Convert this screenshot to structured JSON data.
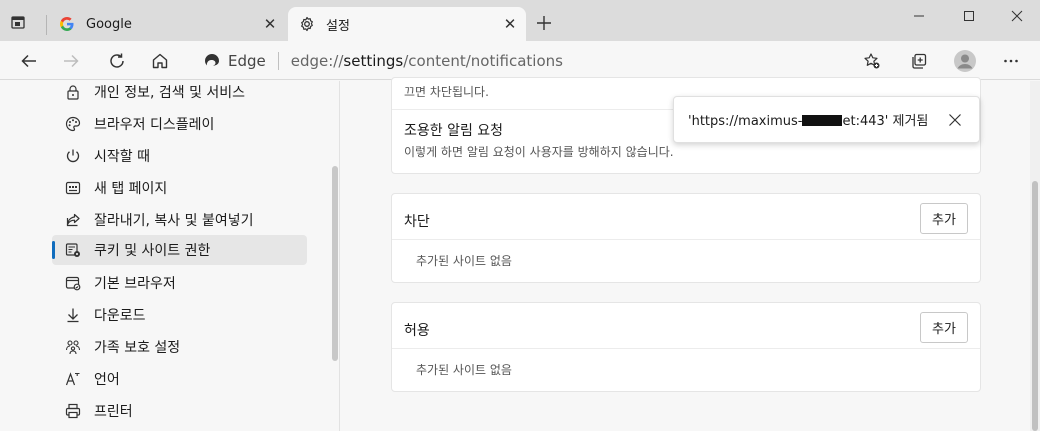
{
  "tabs": [
    {
      "title": "Google",
      "favicon": "google-icon",
      "active": false
    },
    {
      "title": "설정",
      "favicon": "gear-icon",
      "active": true
    }
  ],
  "address": {
    "brand": "Edge",
    "url_prefix": "edge://",
    "url_highlight": "settings",
    "url_suffix": "/content/notifications"
  },
  "sidebar": {
    "items": [
      {
        "label": "개인 정보, 검색 및 서비스",
        "icon": "lock-icon"
      },
      {
        "label": "브라우저 디스플레이",
        "icon": "palette-icon"
      },
      {
        "label": "시작할 때",
        "icon": "power-icon"
      },
      {
        "label": "새 탭 페이지",
        "icon": "newtab-page-icon"
      },
      {
        "label": "잘라내기, 복사 및 붙여넣기",
        "icon": "share-icon"
      },
      {
        "label": "쿠키 및 사이트 권한",
        "icon": "cookie-permissions-icon",
        "selected": true
      },
      {
        "label": "기본 브라우저",
        "icon": "default-browser-icon"
      },
      {
        "label": "다운로드",
        "icon": "download-icon"
      },
      {
        "label": "가족 보호 설정",
        "icon": "family-icon"
      },
      {
        "label": "언어",
        "icon": "language-icon"
      },
      {
        "label": "프린터",
        "icon": "printer-icon"
      }
    ]
  },
  "content": {
    "top_note": "끄면 차단됩니다.",
    "quiet_title": "조용한 알림 요청",
    "quiet_desc": "이렇게 하면 알림 요청이 사용자를 방해하지 않습니다.",
    "block": {
      "title": "차단",
      "add_label": "추가",
      "empty": "추가된 사이트 없음"
    },
    "allow": {
      "title": "허용",
      "add_label": "추가",
      "empty": "추가된 사이트 없음"
    }
  },
  "toast": {
    "msg_start": "'https://maximus-",
    "msg_end": "et:443' 제거됨"
  },
  "colors": {
    "accent": "#0f6cbd"
  }
}
